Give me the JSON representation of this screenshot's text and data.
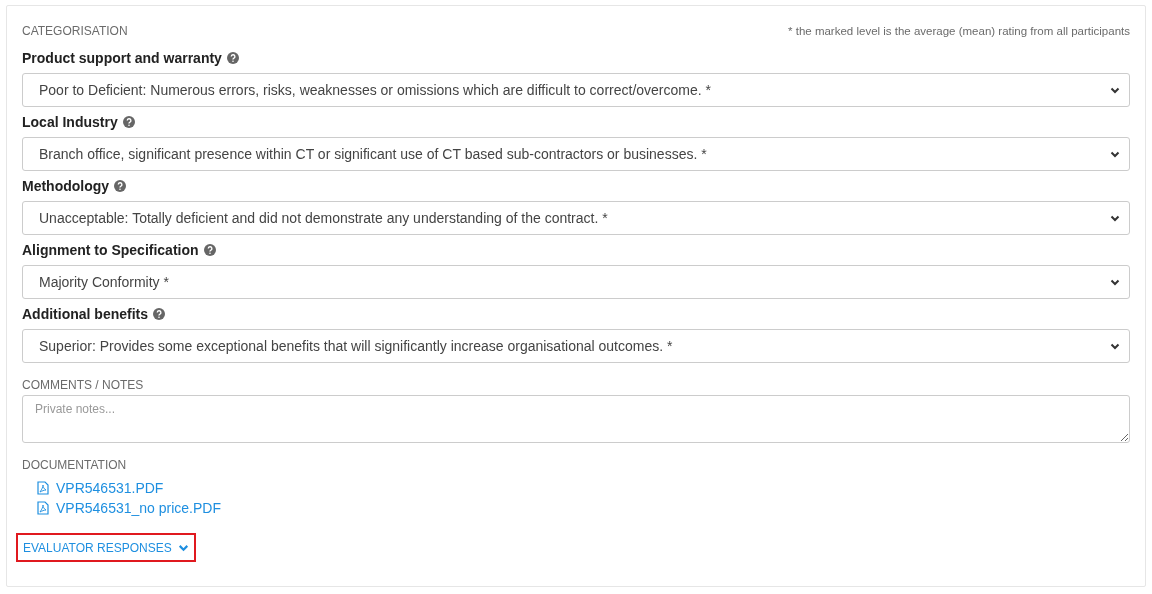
{
  "section_title": "CATEGORISATION",
  "footnote": "* the marked level is the average (mean) rating from all participants",
  "criteria": [
    {
      "label": "Product support and warranty",
      "value": "Poor to Deficient: Numerous errors, risks, weaknesses or omissions which are difficult to correct/overcome. *"
    },
    {
      "label": "Local Industry",
      "value": "Branch office, significant presence within CT or significant use of CT based sub-contractors or businesses. *"
    },
    {
      "label": "Methodology",
      "value": "Unacceptable: Totally deficient and did not demonstrate any understanding of the contract. *"
    },
    {
      "label": "Alignment to Specification",
      "value": "Majority Conformity *"
    },
    {
      "label": "Additional benefits",
      "value": "Superior: Provides some exceptional benefits that will significantly increase organisational outcomes. *"
    }
  ],
  "comments": {
    "label": "COMMENTS / NOTES",
    "placeholder": "Private notes..."
  },
  "documentation": {
    "label": "DOCUMENTATION",
    "files": [
      "VPR546531.PDF",
      "VPR546531_no price.PDF"
    ]
  },
  "evaluator_responses": {
    "label": "EVALUATOR RESPONSES",
    "highlighted": true
  }
}
